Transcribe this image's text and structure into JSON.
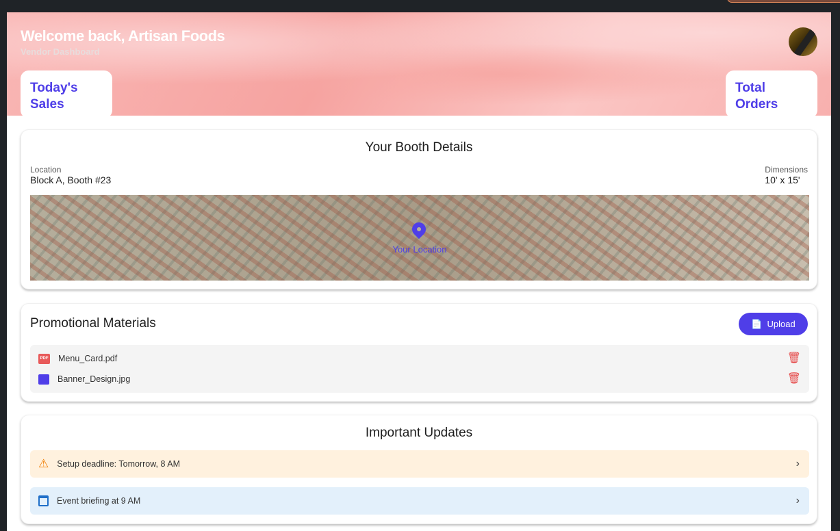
{
  "header": {
    "title": "Welcome back, Artisan Foods",
    "subtitle": "Vendor Dashboard"
  },
  "stats": [
    {
      "label": "Today's Sales"
    },
    {
      "label": "Total Orders"
    }
  ],
  "booth": {
    "title": "Your Booth Details",
    "location_label": "Location",
    "location_value": "Block A, Booth #23",
    "dimensions_label": "Dimensions",
    "dimensions_value": "10' x 15'",
    "map_marker_label": "Your Location"
  },
  "promo": {
    "title": "Promotional Materials",
    "upload_label": "Upload",
    "files": [
      {
        "name": "Menu_Card.pdf",
        "icon": "pdf-icon"
      },
      {
        "name": "Banner_Design.jpg",
        "icon": "image-icon"
      }
    ]
  },
  "updates": {
    "title": "Important Updates",
    "items": [
      {
        "text": "Setup deadline: Tomorrow, 8 AM",
        "icon": "warning-icon",
        "color": "#fff1de"
      },
      {
        "text": "Event briefing at 9 AM",
        "icon": "calendar-icon",
        "color": "#e3f0fb"
      }
    ]
  },
  "colors": {
    "accent": "#4f3ee8",
    "danger": "#e54848"
  }
}
